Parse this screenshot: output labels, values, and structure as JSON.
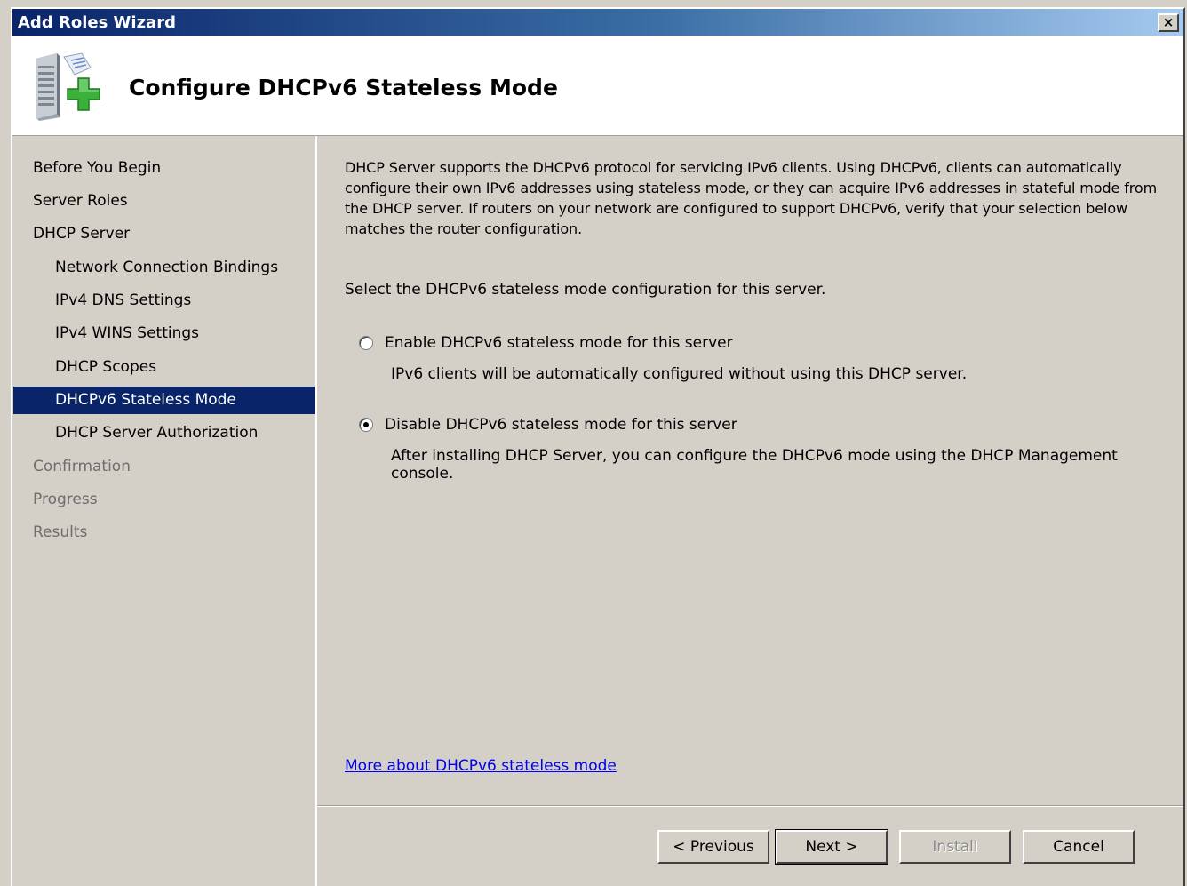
{
  "window": {
    "title": "Add Roles Wizard",
    "close_glyph": "×"
  },
  "header": {
    "title": "Configure DHCPv6 Stateless Mode",
    "icon": "server-add-icon"
  },
  "sidebar": {
    "items": [
      {
        "label": "Before You Begin",
        "level": 0,
        "state": "normal"
      },
      {
        "label": "Server Roles",
        "level": 0,
        "state": "normal"
      },
      {
        "label": "DHCP Server",
        "level": 0,
        "state": "normal"
      },
      {
        "label": "Network Connection Bindings",
        "level": 1,
        "state": "normal"
      },
      {
        "label": "IPv4 DNS Settings",
        "level": 1,
        "state": "normal"
      },
      {
        "label": "IPv4 WINS Settings",
        "level": 1,
        "state": "normal"
      },
      {
        "label": "DHCP Scopes",
        "level": 1,
        "state": "normal"
      },
      {
        "label": "DHCPv6 Stateless Mode",
        "level": 1,
        "state": "active"
      },
      {
        "label": "DHCP Server Authorization",
        "level": 1,
        "state": "normal"
      },
      {
        "label": "Confirmation",
        "level": 0,
        "state": "disabled"
      },
      {
        "label": "Progress",
        "level": 0,
        "state": "disabled"
      },
      {
        "label": "Results",
        "level": 0,
        "state": "disabled"
      }
    ]
  },
  "main": {
    "description": "DHCP Server supports the DHCPv6 protocol for servicing IPv6 clients. Using DHCPv6, clients can automatically configure their own IPv6 addresses using stateless mode, or they can acquire IPv6 addresses in stateful mode from the DHCP server. If routers on your network are configured to support DHCPv6, verify that your selection below matches the router configuration.",
    "prompt": "Select the DHCPv6 stateless mode configuration for this server.",
    "options": [
      {
        "label": "Enable DHCPv6 stateless mode for this server",
        "help": "IPv6 clients will be automatically configured without using this DHCP server.",
        "selected": false
      },
      {
        "label": "Disable DHCPv6 stateless mode for this server",
        "help": "After installing DHCP Server, you can configure the DHCPv6 mode using the DHCP Management console.",
        "selected": true
      }
    ],
    "more_link": "More about DHCPv6 stateless mode"
  },
  "buttons": {
    "previous": "< Previous",
    "next": "Next >",
    "install": "Install",
    "cancel": "Cancel"
  },
  "colors": {
    "title_gradient_start": "#0a246a",
    "title_gradient_end": "#a6caf0",
    "selection": "#0a246a",
    "face": "#d4d0c8",
    "link": "#0000ee"
  }
}
